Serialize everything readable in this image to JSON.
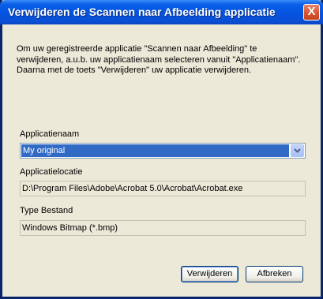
{
  "dialog": {
    "title": "Verwijderen de Scannen naar Afbeelding applicatie",
    "close_label": "X",
    "description": "Om uw geregistreerde applicatie \"Scannen naar Afbeelding\" te verwijderen, a.u.b. uw applicatienaam selecteren vanuit \"Applicatienaam\". Daarna met de toets \"Verwijderen\" uw applicatie verwijderen."
  },
  "fields": {
    "app_name_label": "Applicatienaam",
    "app_name_value": "My original",
    "location_label": "Applicatielocatie",
    "location_value": "D:\\Program Files\\Adobe\\Acrobat 5.0\\Acrobat\\Acrobat.exe",
    "type_label": "Type Bestand",
    "type_value": "Windows Bitmap (*.bmp)"
  },
  "buttons": {
    "delete": "Verwijderen",
    "cancel": "Afbreken"
  },
  "colors": {
    "titlebar": "#0454e0",
    "selection": "#316ac5",
    "face": "#ece9d8"
  }
}
